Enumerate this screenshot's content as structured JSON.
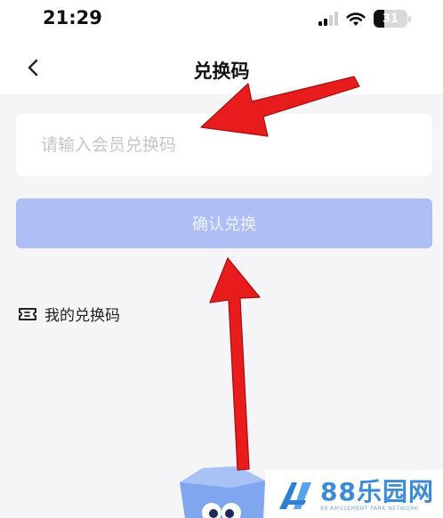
{
  "status_bar": {
    "time": "21:29",
    "battery": "31",
    "battery_level": 0.31
  },
  "nav": {
    "title": "兑换码"
  },
  "redeem_input": {
    "value": "",
    "placeholder": "请输入会员兑换码"
  },
  "confirm_button": {
    "label": "确认兑换",
    "color": "#aebff6"
  },
  "my_codes": {
    "label": "我的兑换码"
  },
  "annotations": {
    "arrow_color": "#e81c1c"
  },
  "watermark": {
    "brand": "88乐园网",
    "tagline": "88 AMUSEMENT PARK NETWORK"
  },
  "icons": [
    "back-chevron-icon",
    "signal-icon",
    "wifi-icon",
    "battery-icon",
    "ticket-icon",
    "watermark-logo-icon",
    "mascot-image"
  ]
}
